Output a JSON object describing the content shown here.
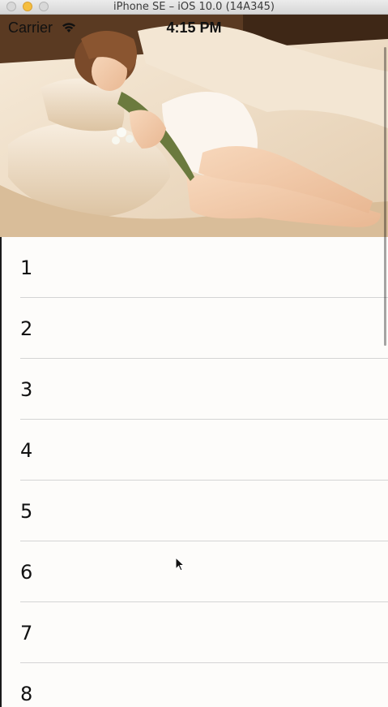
{
  "window": {
    "title": "iPhone SE – iOS 10.0 (14A345)"
  },
  "status_bar": {
    "carrier": "Carrier",
    "wifi_icon": "wifi-icon",
    "time": "4:15 PM"
  },
  "hero": {
    "image": "photo of a woman sleeping on a bed with flowers"
  },
  "list": {
    "rows": [
      "1",
      "2",
      "3",
      "4",
      "5",
      "6",
      "7",
      "8"
    ]
  },
  "colors": {
    "background": "#fdfcfa",
    "separator": "#d4d4d4",
    "text": "#111111",
    "minimize_button": "#f5be3f"
  }
}
